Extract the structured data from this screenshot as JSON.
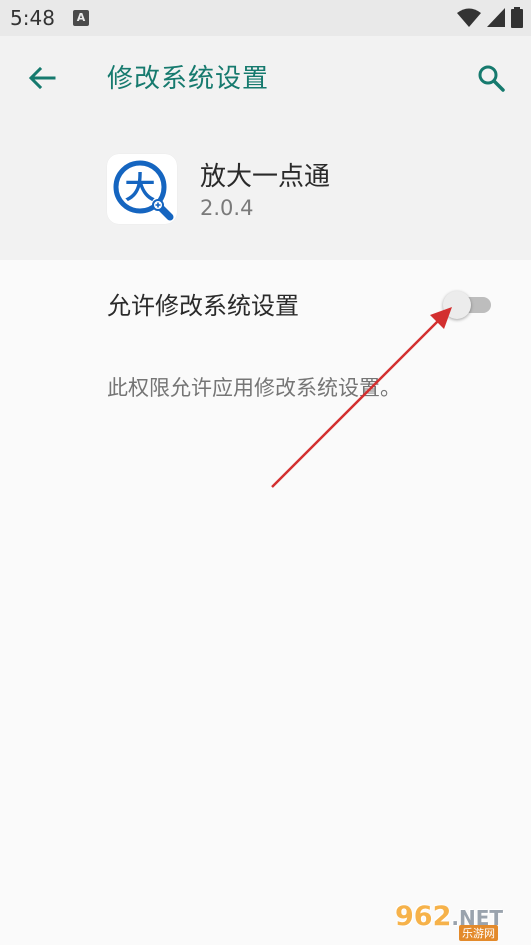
{
  "status_bar": {
    "time": "5:48",
    "notification_letter": "A"
  },
  "app_bar": {
    "title": "修改系统设置"
  },
  "app": {
    "name": "放大一点通",
    "version": "2.0.4",
    "icon_glyph": "大"
  },
  "setting": {
    "label": "允许修改系统设置",
    "summary": "此权限允许应用修改系统设置。",
    "toggle_on": false
  },
  "watermark": {
    "main": "962",
    "net": ".NET",
    "sub": "乐游网"
  },
  "colors": {
    "accent": "#167a6e",
    "icon_blue": "#1565c0",
    "arrow_red": "#d32f2f"
  }
}
